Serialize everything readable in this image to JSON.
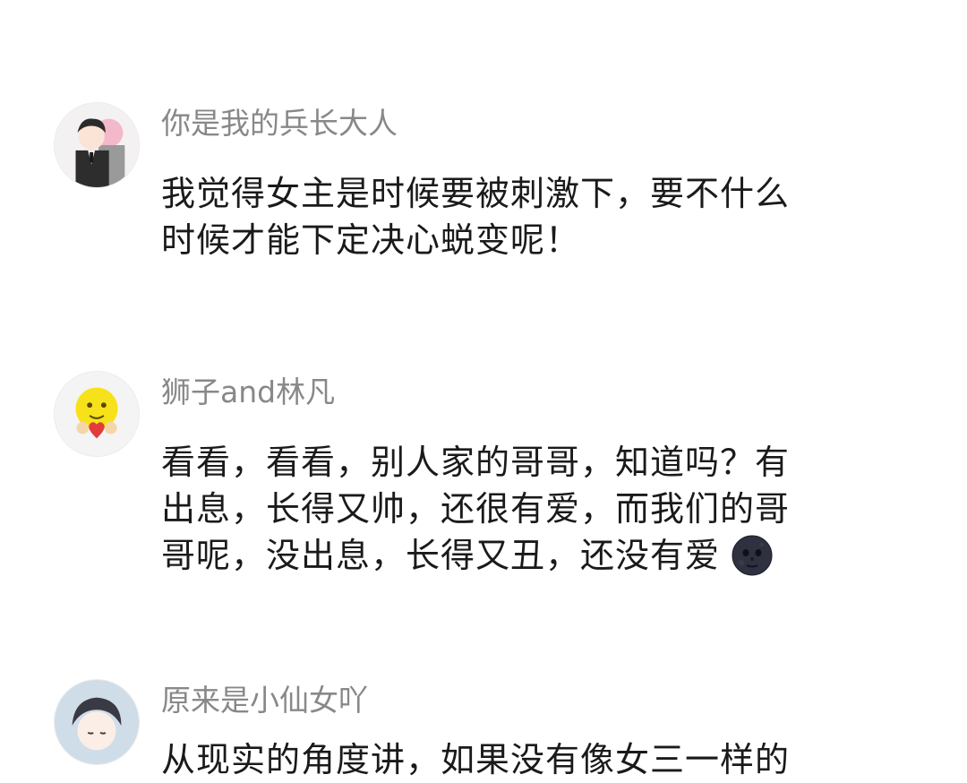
{
  "comments": [
    {
      "username": "你是我的兵长大人",
      "lines": [
        "我觉得女主是时候要被刺激下，要不什么",
        "时候才能下定决心蜕变呢！"
      ]
    },
    {
      "username": "狮子and林凡",
      "lines": [
        "看看，看看，别人家的哥哥，知道吗？有",
        "出息，长得又帅，还很有爱，而我们的哥",
        "哥呢，没出息，长得又丑，还没有爱"
      ],
      "trailing_emoji": "new-moon-face-emoji"
    },
    {
      "username": "原来是小仙女吖",
      "lines": [
        "从现实的角度讲，如果没有像女三一样的"
      ]
    }
  ]
}
